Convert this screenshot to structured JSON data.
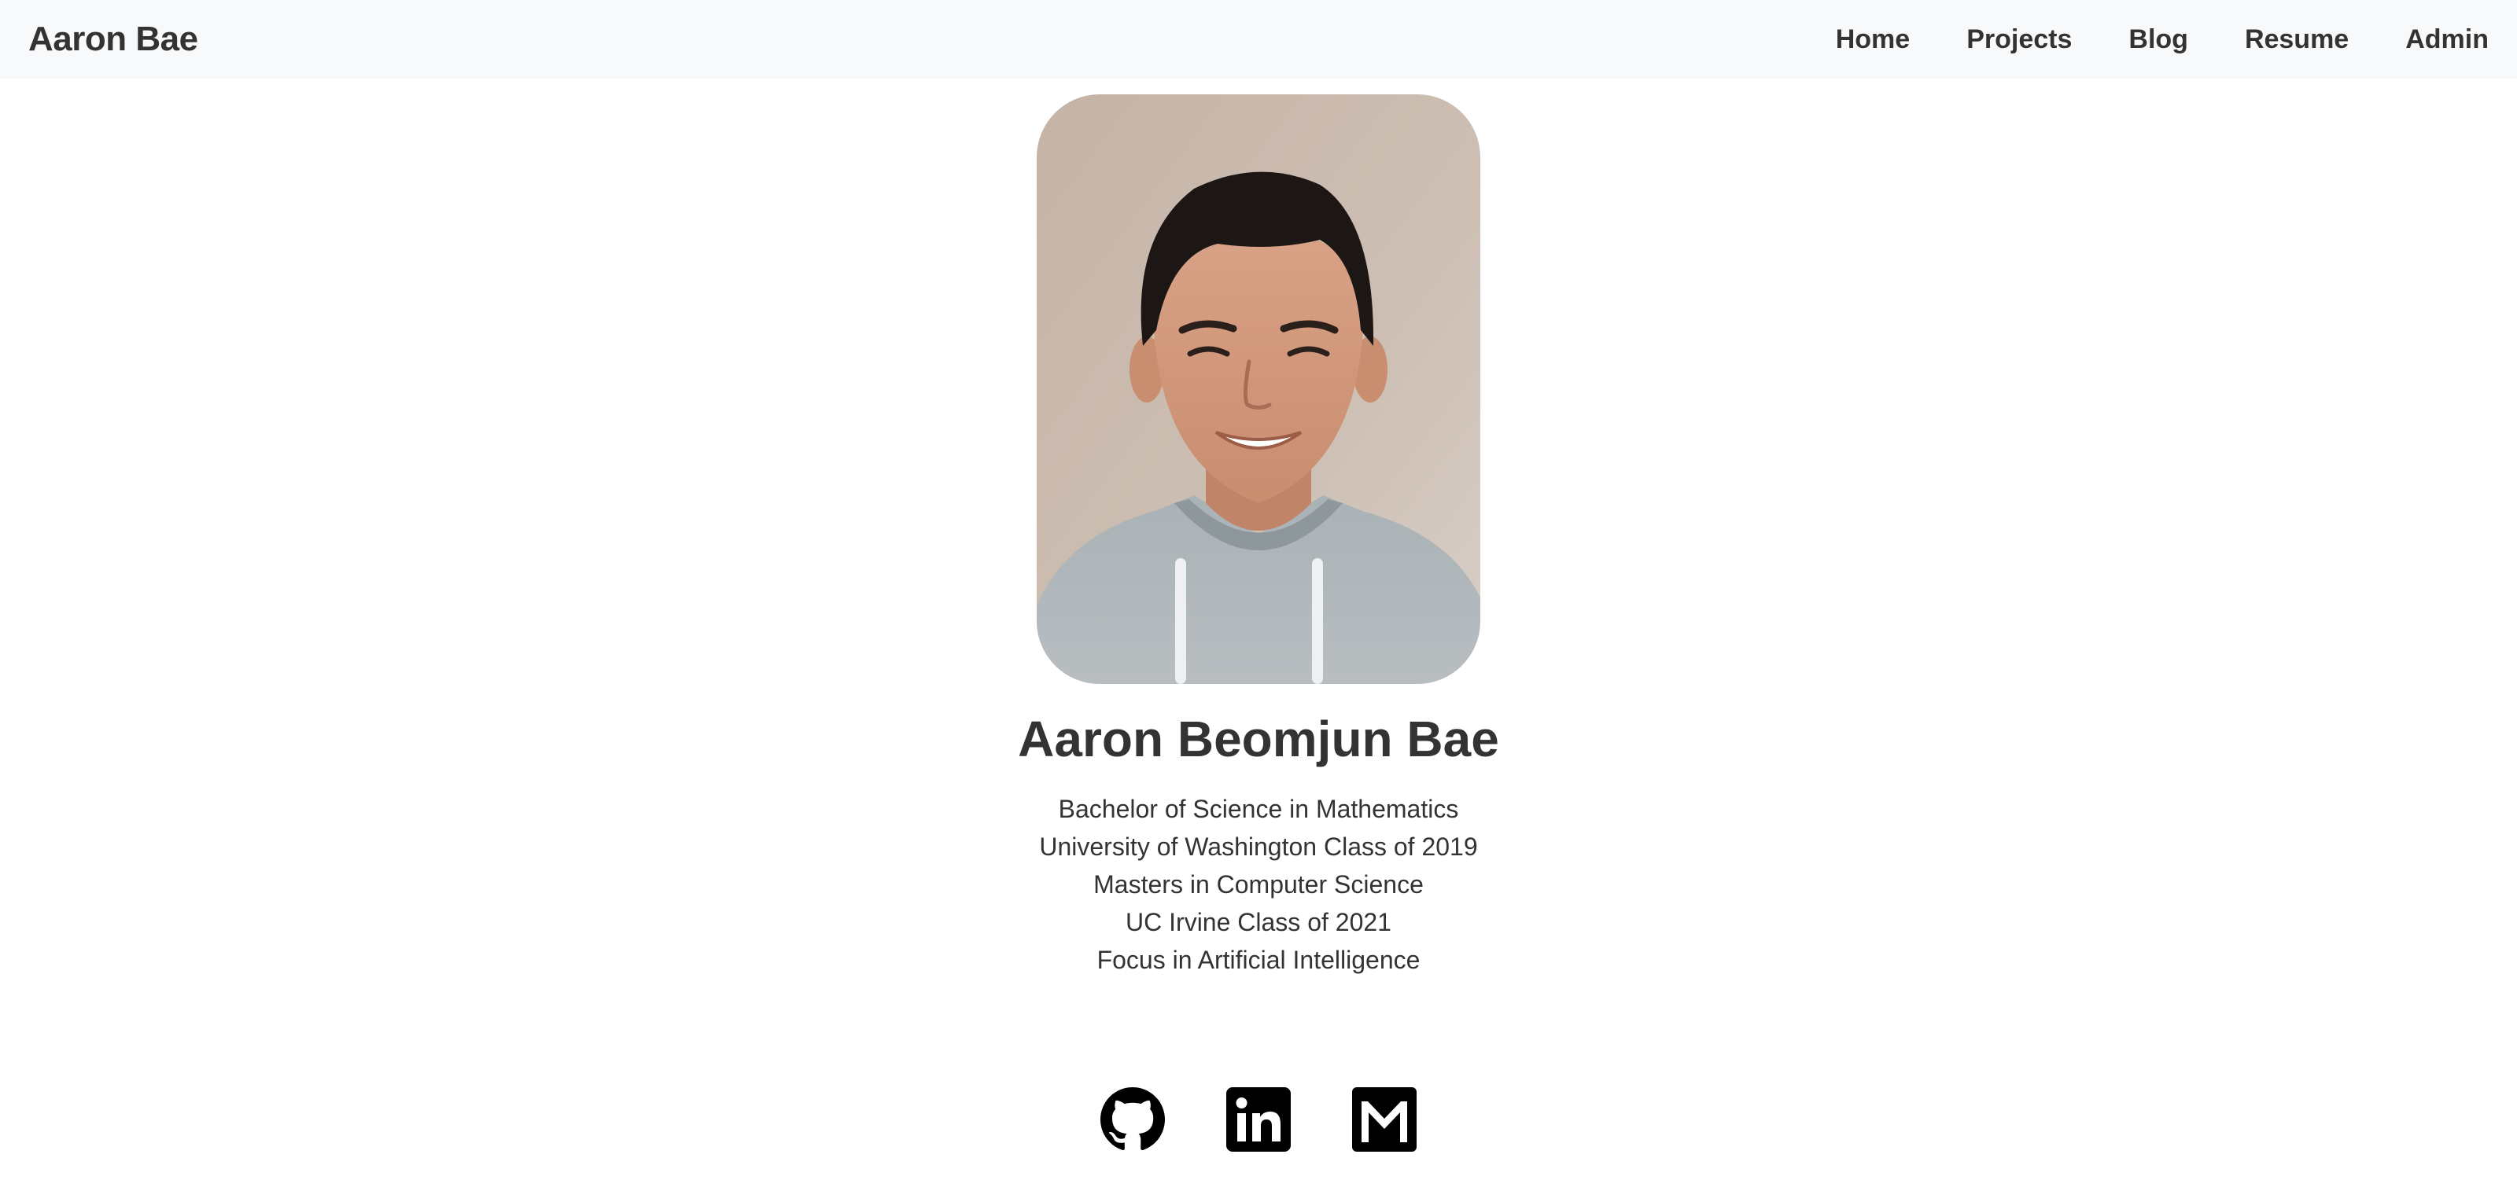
{
  "navbar": {
    "brand": "Aaron Bae",
    "links": [
      {
        "label": "Home"
      },
      {
        "label": "Projects"
      },
      {
        "label": "Blog"
      },
      {
        "label": "Resume"
      },
      {
        "label": "Admin"
      }
    ]
  },
  "profile": {
    "photo_alt": "profile-photo",
    "name": "Aaron Beomjun Bae",
    "details": [
      "Bachelor of Science in Mathematics",
      "University of Washington Class of 2019",
      "Masters in Computer Science",
      "UC Irvine Class of 2021",
      "Focus in Artificial Intelligence"
    ]
  },
  "socials": [
    {
      "icon": "github-icon"
    },
    {
      "icon": "linkedin-icon"
    },
    {
      "icon": "gmail-icon"
    }
  ],
  "colors": {
    "navbar_bg": "#f8f9fa",
    "text": "#333333",
    "icon": "#000000"
  }
}
